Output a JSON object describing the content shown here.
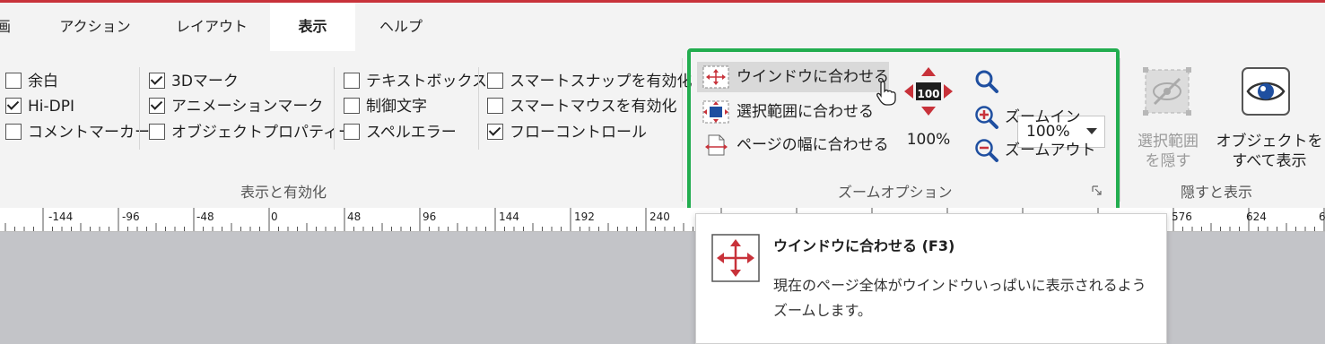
{
  "tabs": [
    {
      "label": "画"
    },
    {
      "label": "アクション"
    },
    {
      "label": "レイアウト"
    },
    {
      "label": "表示",
      "active": true
    },
    {
      "label": "ヘルプ"
    }
  ],
  "display_group": {
    "label": "表示と有効化",
    "checkboxes": [
      {
        "label": "余白",
        "checked": false
      },
      {
        "label": "Hi-DPI",
        "checked": true
      },
      {
        "label": "コメントマーカー",
        "checked": false
      },
      {
        "label": "3Dマーク",
        "checked": true
      },
      {
        "label": "アニメーションマーク",
        "checked": true
      },
      {
        "label": "オブジェクトプロパティー",
        "checked": false
      },
      {
        "label": "テキストボックス",
        "checked": false
      },
      {
        "label": "制御文字",
        "checked": false
      },
      {
        "label": "スペルエラー",
        "checked": false
      },
      {
        "label": "スマートスナップを有効化",
        "checked": false
      },
      {
        "label": "スマートマウスを有効化",
        "checked": false
      },
      {
        "label": "フローコントロール",
        "checked": true
      }
    ]
  },
  "zoom_group": {
    "label": "ズームオプション",
    "fit_window": "ウインドウに合わせる",
    "fit_selection": "選択範囲に合わせる",
    "fit_page_width": "ページの幅に合わせる",
    "zoom_icon_value": "100",
    "zoom_percent": "100%",
    "zoom_select_value": "100%",
    "zoom_in": "ズームイン",
    "zoom_out": "ズームアウト"
  },
  "hide_group": {
    "label": "隠すと表示",
    "hide_selection_line1": "選択範囲",
    "hide_selection_line2": "を隠す",
    "show_all_line1": "オブジェクトを",
    "show_all_line2": "すべて表示"
  },
  "ruler": {
    "labels": [
      "-144",
      "-96",
      "-48",
      "0",
      "48",
      "96",
      "144",
      "192",
      "240",
      "576",
      "624",
      "6"
    ]
  },
  "tooltip": {
    "title": "ウインドウに合わせる (F3)",
    "body": "現在のページ全体がウインドウいっぱいに表示されるようズームします。"
  },
  "colors": {
    "accent_red": "#c8323a",
    "highlight_green": "#22ad4f",
    "icon_blue": "#1f4fa0"
  }
}
